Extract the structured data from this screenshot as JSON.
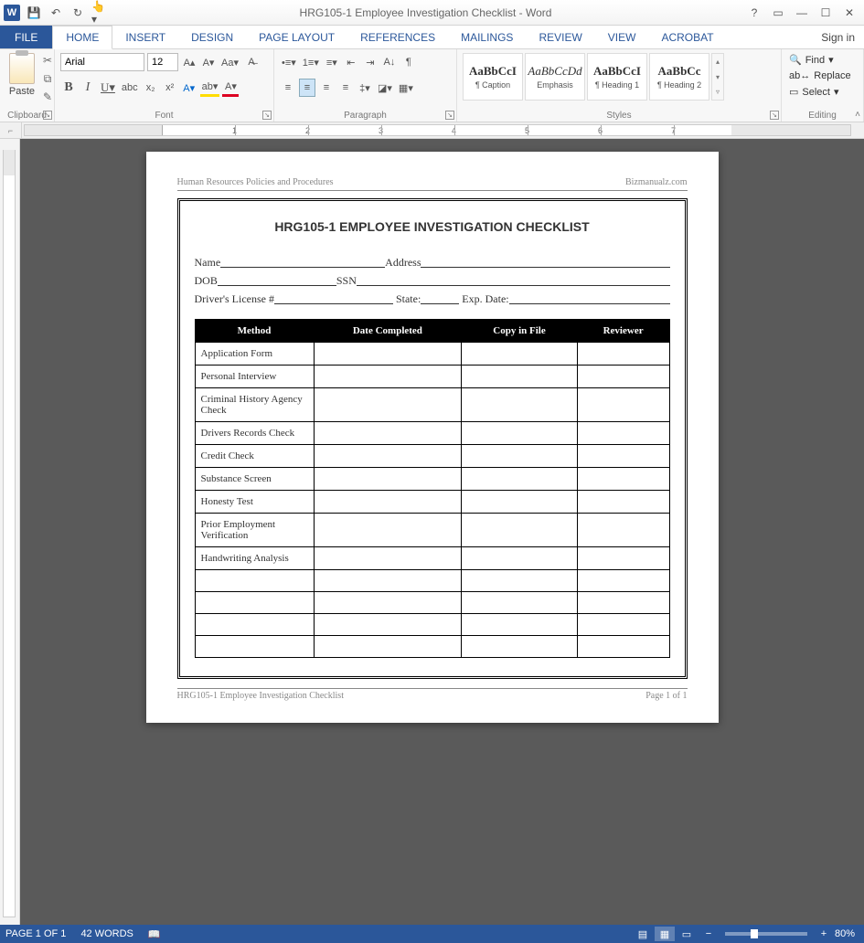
{
  "window": {
    "title": "HRG105-1 Employee Investigation Checklist - Word",
    "signin": "Sign in"
  },
  "tabs": {
    "file": "FILE",
    "home": "HOME",
    "insert": "INSERT",
    "design": "DESIGN",
    "page_layout": "PAGE LAYOUT",
    "references": "REFERENCES",
    "mailings": "MAILINGS",
    "review": "REVIEW",
    "view": "VIEW",
    "acrobat": "ACROBAT"
  },
  "clipboard": {
    "paste": "Paste",
    "label": "Clipboard"
  },
  "font": {
    "name": "Arial",
    "size": "12",
    "label": "Font"
  },
  "paragraph": {
    "label": "Paragraph"
  },
  "styles": {
    "label": "Styles",
    "items": [
      {
        "sample": "AaBbCcI",
        "name": "¶ Caption"
      },
      {
        "sample": "AaBbCcDd",
        "name": "Emphasis"
      },
      {
        "sample": "AaBbCcI",
        "name": "¶ Heading 1"
      },
      {
        "sample": "AaBbCc",
        "name": "¶ Heading 2"
      }
    ]
  },
  "editing": {
    "find": "Find",
    "replace": "Replace",
    "select": "Select",
    "label": "Editing"
  },
  "document": {
    "header_left": "Human Resources Policies and Procedures",
    "header_right": "Bizmanualz.com",
    "title": "HRG105-1 EMPLOYEE INVESTIGATION CHECKLIST",
    "fields": {
      "name": "Name",
      "address": "Address",
      "dob": "DOB",
      "ssn": "SSN",
      "license": "Driver's License #",
      "state": "State:",
      "exp": "Exp. Date:"
    },
    "table": {
      "headers": [
        "Method",
        "Date Completed",
        "Copy in File",
        "Reviewer"
      ],
      "rows": [
        "Application Form",
        "Personal Interview",
        "Criminal History Agency Check",
        "Drivers Records Check",
        "Credit Check",
        "Substance Screen",
        "Honesty Test",
        "Prior Employment Verification",
        "Handwriting Analysis",
        "",
        "",
        "",
        ""
      ]
    },
    "footer_left": "HRG105-1 Employee Investigation Checklist",
    "footer_right": "Page 1 of 1"
  },
  "status": {
    "page": "PAGE 1 OF 1",
    "words": "42 WORDS",
    "zoom": "80%"
  }
}
